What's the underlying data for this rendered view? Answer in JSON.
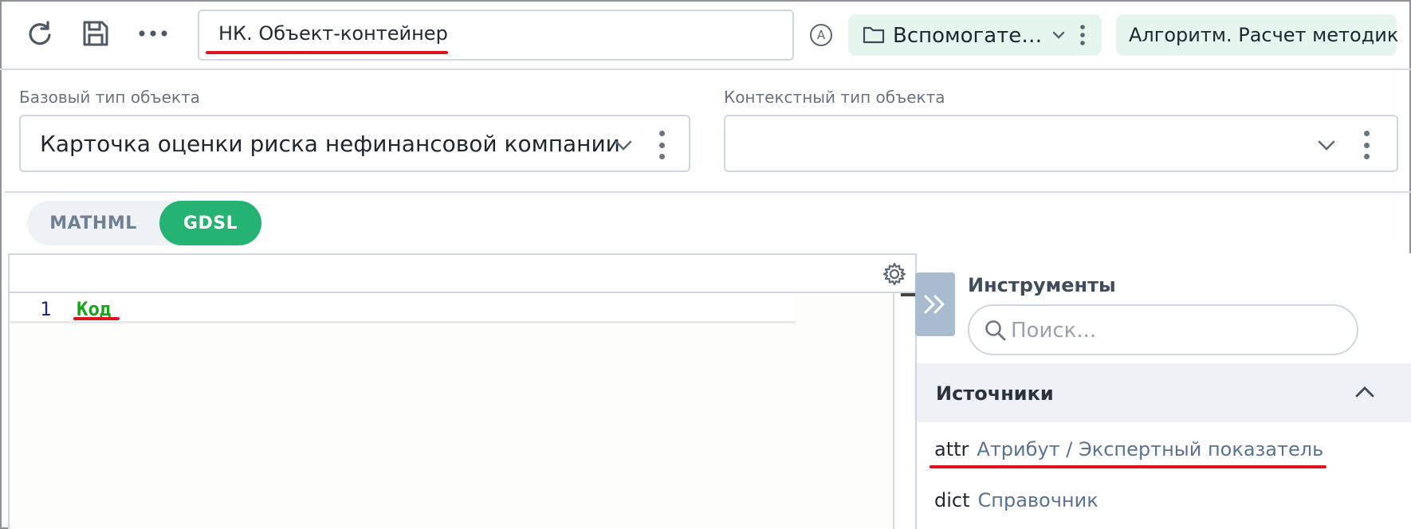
{
  "toolbar": {
    "refresh_icon": "refresh-icon",
    "save_icon": "save-icon",
    "more_icon": "more-horizontal-icon",
    "title_value": "НК. Объект-контейнер",
    "status_letter": "A",
    "folder": {
      "icon": "folder-icon",
      "label": "Вспомогате…"
    },
    "algorithm_label": "Алгоритм. Расчет методик"
  },
  "object_types": {
    "base": {
      "label": "Базовый тип объекта",
      "value": "Карточка оценки риска нефинансовой компании"
    },
    "context": {
      "label": "Контекстный тип объекта",
      "value": ""
    }
  },
  "mode_toggle": {
    "options": [
      "MATHML",
      "GDSL"
    ],
    "active": "GDSL"
  },
  "editor": {
    "lines": [
      {
        "number": "1",
        "code": "Код"
      }
    ],
    "settings_icon": "gear-icon"
  },
  "tools": {
    "title": "Инструменты",
    "search_placeholder": "Поиск...",
    "sources": {
      "title": "Источники",
      "items": [
        {
          "key": "attr",
          "description": "Атрибут / Экспертный показатель"
        },
        {
          "key": "dict",
          "description": "Справочник"
        }
      ]
    }
  },
  "colors": {
    "accent": "#24b373",
    "chip_bg": "#e6f5ee",
    "annotation_red": "#e0141e",
    "code_green": "#17a31a"
  }
}
